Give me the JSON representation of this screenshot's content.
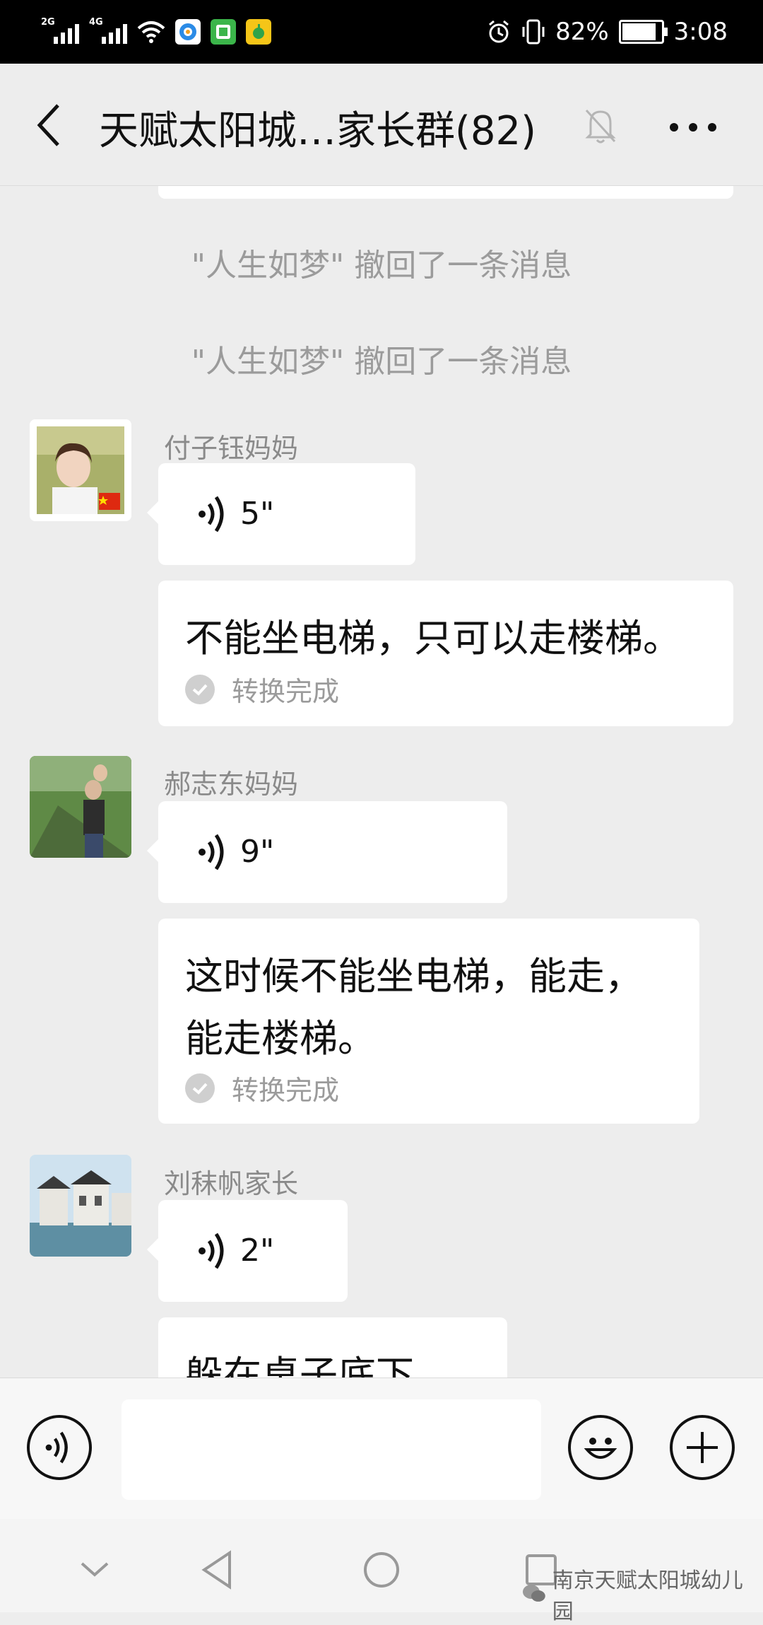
{
  "status_bar": {
    "network_1": "2G",
    "network_2": "4G",
    "battery": "82%",
    "time": "3:08",
    "app_icons": [
      "qq-browser-icon",
      "app-green-icon",
      "music-icon"
    ]
  },
  "header": {
    "title": "天赋太阳城…家长群(82)",
    "back_icon": "chevron-left-icon",
    "mute_icon": "bell-off-icon",
    "more_icon": "more-dots-icon"
  },
  "system_messages": [
    "\"人生如梦\" 撤回了一条消息",
    "\"人生如梦\" 撤回了一条消息"
  ],
  "messages": [
    {
      "sender": "付子钰妈妈",
      "voice_duration": "5\"",
      "transcript": "不能坐电梯，只可以走楼梯。",
      "status": "转换完成"
    },
    {
      "sender": "郝志东妈妈",
      "voice_duration": "9\"",
      "transcript": "这时候不能坐电梯，能走，能走楼梯。",
      "status": "转换完成"
    },
    {
      "sender": "刘秣帆家长",
      "voice_duration": "2\"",
      "transcript": "躲在桌子底下。"
    }
  ],
  "input_bar": {
    "voice_icon": "voice-input-icon",
    "emoji_icon": "emoji-icon",
    "plus_icon": "plus-icon",
    "placeholder": ""
  },
  "nav_bar": {
    "icons": [
      "chevron-down-icon",
      "back-triangle-icon",
      "home-circle-icon",
      "recents-square-icon"
    ],
    "watermark": "南京天赋太阳城幼儿园"
  },
  "colors": {
    "background": "#ededed",
    "bubble": "#ffffff",
    "status_bar": "#000000"
  }
}
